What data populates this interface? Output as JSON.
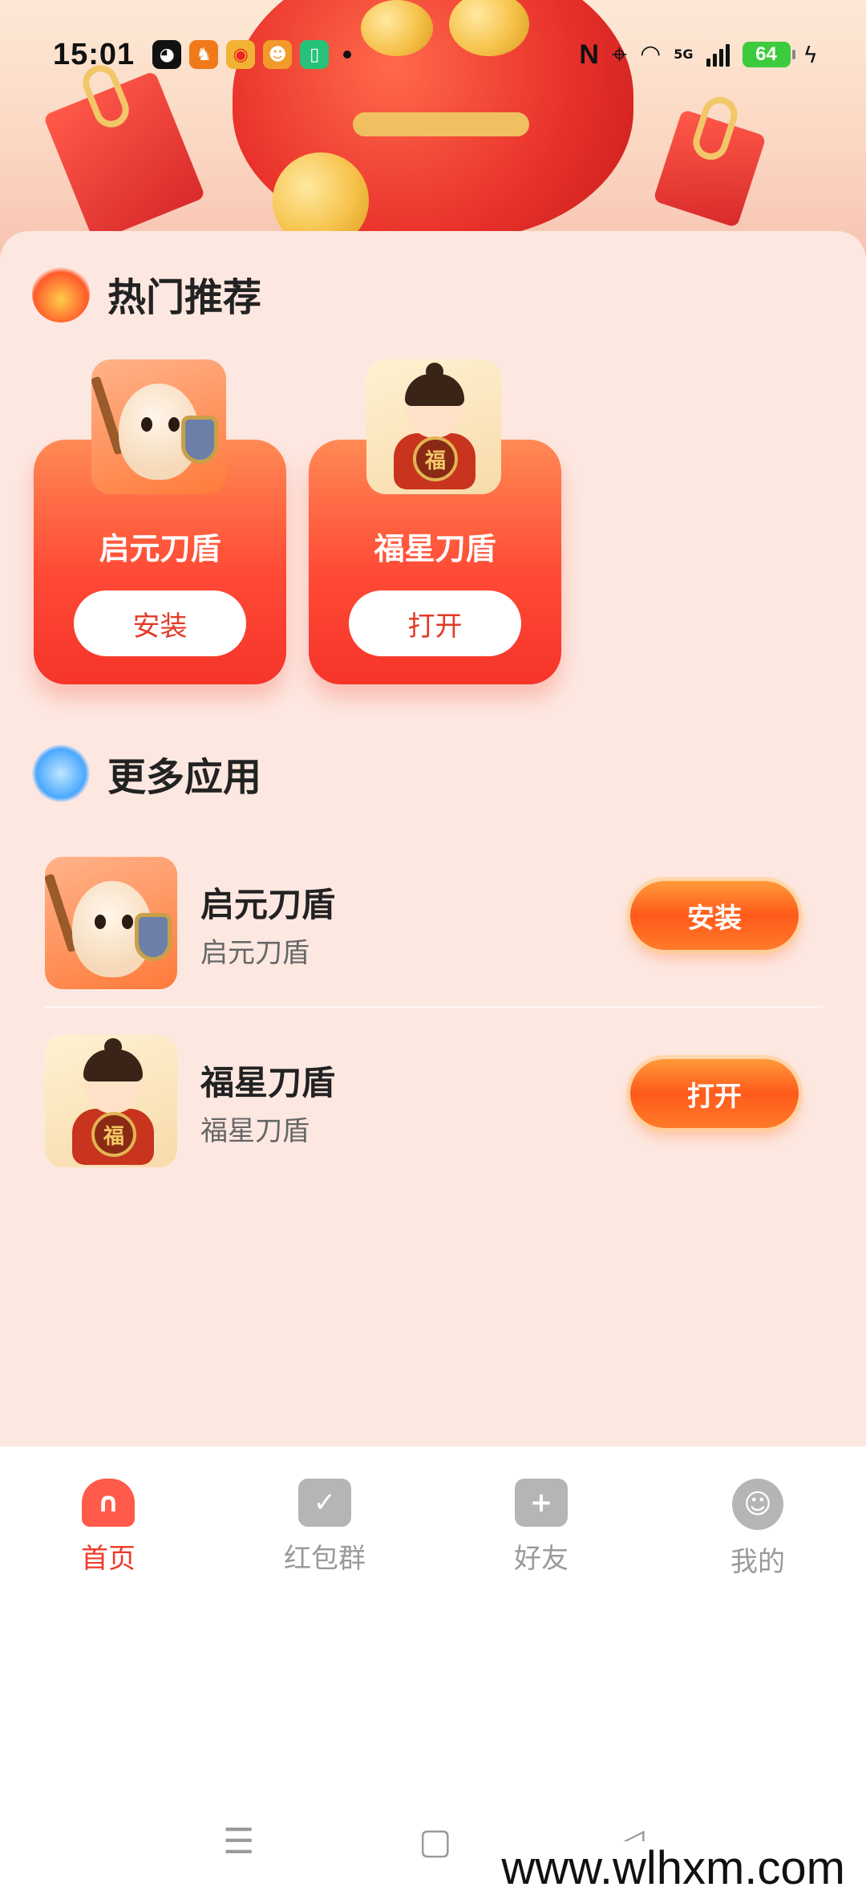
{
  "status_bar": {
    "time": "15:01",
    "network": "5G",
    "battery": "64"
  },
  "hot_section": {
    "title": "热门推荐",
    "cards": [
      {
        "name": "启元刀盾",
        "button": "安装"
      },
      {
        "name": "福星刀盾",
        "button": "打开"
      }
    ]
  },
  "more_section": {
    "title": "更多应用",
    "items": [
      {
        "title": "启元刀盾",
        "subtitle": "启元刀盾",
        "button": "安装"
      },
      {
        "title": "福星刀盾",
        "subtitle": "福星刀盾",
        "button": "打开"
      }
    ]
  },
  "medal_char": "福",
  "bottom_nav": [
    {
      "label": "首页",
      "icon": "home-icon",
      "active": true
    },
    {
      "label": "红包群",
      "icon": "red-packet-group-icon",
      "active": false
    },
    {
      "label": "好友",
      "icon": "add-friend-icon",
      "active": false
    },
    {
      "label": "我的",
      "icon": "profile-icon",
      "active": false
    }
  ],
  "watermark": "www.wlhxm.com",
  "colors": {
    "accent": "#ff4a35",
    "sheet_bg": "#fde8e1",
    "nav_active": "#ef3a2a"
  }
}
